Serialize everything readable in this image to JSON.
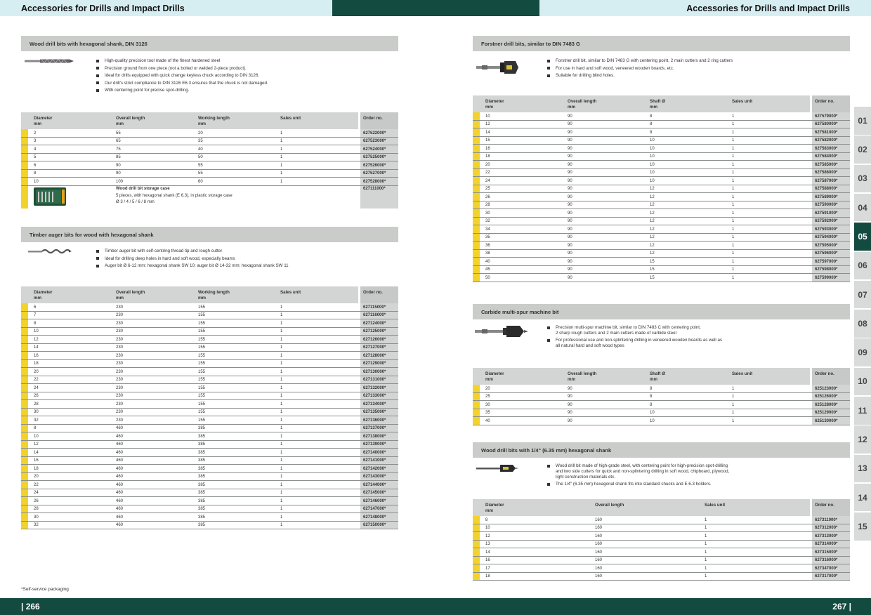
{
  "header": {
    "title_left": "Accessories for Drills and Impact Drills",
    "title_right": "Accessories for Drills and Impact Drills"
  },
  "footer": {
    "page_left": "| 266",
    "page_right": "267 |",
    "footnote": "*Self-service packaging"
  },
  "colors": {
    "dark_green": "#134b41",
    "light_blue": "#d6eef2",
    "yellow": "#f2d32e",
    "gray_bar": "#c9ccc9"
  },
  "tabs": [
    "01",
    "02",
    "03",
    "04",
    "05",
    "06",
    "07",
    "08",
    "09",
    "10",
    "11",
    "12",
    "13",
    "14",
    "15"
  ],
  "active_tab": "05",
  "sections": {
    "wood_hex": {
      "title": "Wood drill bits with hexagonal shank, DIN 3126",
      "bullets": [
        "High-quality precision tool made of the finest hardened steel",
        "Precision ground from one piece (not a bolted or welded 2-piece product).",
        "Ideal for drills equipped with quick change keyless chuck according to DIN 3126.",
        "Our drill's strict compliance to DIN 3126 E6.3 ensures that the chuck is not damaged.",
        "With centering point for precise spot-drilling."
      ],
      "headers": {
        "c1a": "Diameter",
        "c1b": "mm",
        "c2a": "Overall length",
        "c2b": "mm",
        "c3a": "Working length",
        "c3b": "mm",
        "c4": "Sales unit",
        "c5": "Order no."
      },
      "rows": [
        [
          "2",
          "55",
          "20",
          "1",
          "627522000*"
        ],
        [
          "3",
          "65",
          "35",
          "1",
          "627523000*"
        ],
        [
          "4",
          "75",
          "40",
          "1",
          "627524000*"
        ],
        [
          "5",
          "85",
          "50",
          "1",
          "627525000*"
        ],
        [
          "6",
          "90",
          "55",
          "1",
          "627526000*"
        ],
        [
          "8",
          "90",
          "55",
          "1",
          "627527000*"
        ],
        [
          "10",
          "100",
          "60",
          "1",
          "627528000*"
        ]
      ],
      "case": {
        "title": "Wood drill bit storage case",
        "line1": "5 pieces, with hexagonal shank (E 6.3), in plastic storage case",
        "line2": "Ø 3 / 4 / 5 / 6 / 8 mm",
        "order": "627111000*"
      }
    },
    "auger": {
      "title": "Timber auger bits for wood with hexagonal shank",
      "bullets": [
        "Timber auger bit with self-centring thread tip and rough cutter",
        "Ideal for drilling deep holes in hard and soft wood, especially beams",
        "Auger bit Ø 6-12 mm: hexagonal shank SW 10; auger bit Ø 14-32 mm: hexagonal shank SW 11"
      ],
      "headers": {
        "c1a": "Diameter",
        "c1b": "mm",
        "c2a": "Overall length",
        "c2b": "mm",
        "c3a": "Working length",
        "c3b": "mm",
        "c4": "Sales unit",
        "c5": "Order no."
      },
      "rows": [
        [
          "6",
          "230",
          "155",
          "1",
          "627115000*"
        ],
        [
          "7",
          "230",
          "155",
          "1",
          "627116000*"
        ],
        [
          "8",
          "230",
          "155",
          "1",
          "627124000*"
        ],
        [
          "10",
          "230",
          "155",
          "1",
          "627125000*"
        ],
        [
          "12",
          "230",
          "155",
          "1",
          "627126000*"
        ],
        [
          "14",
          "230",
          "155",
          "1",
          "627127000*"
        ],
        [
          "16",
          "230",
          "155",
          "1",
          "627128000*"
        ],
        [
          "18",
          "230",
          "155",
          "1",
          "627129000*"
        ],
        [
          "20",
          "230",
          "155",
          "1",
          "627130000*"
        ],
        [
          "22",
          "230",
          "155",
          "1",
          "627131000*"
        ],
        [
          "24",
          "230",
          "155",
          "1",
          "627132000*"
        ],
        [
          "26",
          "230",
          "155",
          "1",
          "627133000*"
        ],
        [
          "28",
          "230",
          "155",
          "1",
          "627134000*"
        ],
        [
          "30",
          "230",
          "155",
          "1",
          "627135000*"
        ],
        [
          "32",
          "230",
          "155",
          "1",
          "627136000*"
        ],
        [
          "8",
          "460",
          "385",
          "1",
          "627137000*"
        ],
        [
          "10",
          "460",
          "385",
          "1",
          "627138000*"
        ],
        [
          "12",
          "460",
          "385",
          "1",
          "627139000*"
        ],
        [
          "14",
          "460",
          "385",
          "1",
          "627140000*"
        ],
        [
          "16",
          "460",
          "385",
          "1",
          "627141000*"
        ],
        [
          "18",
          "460",
          "385",
          "1",
          "627142000*"
        ],
        [
          "20",
          "460",
          "385",
          "1",
          "627143000*"
        ],
        [
          "22",
          "460",
          "385",
          "1",
          "627144000*"
        ],
        [
          "24",
          "460",
          "385",
          "1",
          "627145000*"
        ],
        [
          "26",
          "460",
          "385",
          "1",
          "627146000*"
        ],
        [
          "28",
          "460",
          "385",
          "1",
          "627147000*"
        ],
        [
          "30",
          "460",
          "385",
          "1",
          "627148000*"
        ],
        [
          "32",
          "460",
          "385",
          "1",
          "627150000*"
        ]
      ]
    },
    "forstner": {
      "title": "Forstner drill bits, similar to DIN 7483 G",
      "bullets": [
        "Forstner drill bit, similar to DIN 7483 G with centering point, 2 main cutters and 2 ring cutters",
        "For use in hard and soft wood, veneered wooden boards, etc.",
        "Suitable for drilling blind holes."
      ],
      "headers": {
        "c1a": "Diameter",
        "c1b": "mm",
        "c2a": "Overall length",
        "c2b": "mm",
        "c3a": "Shaft Ø",
        "c3b": "mm",
        "c4": "Sales unit",
        "c5": "Order no."
      },
      "rows": [
        [
          "10",
          "90",
          "8",
          "1",
          "627579000*"
        ],
        [
          "12",
          "90",
          "8",
          "1",
          "627580000*"
        ],
        [
          "14",
          "90",
          "8",
          "1",
          "627581000*"
        ],
        [
          "15",
          "90",
          "10",
          "1",
          "627582000*"
        ],
        [
          "16",
          "90",
          "10",
          "1",
          "627583000*"
        ],
        [
          "18",
          "90",
          "10",
          "1",
          "627584000*"
        ],
        [
          "20",
          "90",
          "10",
          "1",
          "627585000*"
        ],
        [
          "22",
          "90",
          "10",
          "1",
          "627586000*"
        ],
        [
          "24",
          "90",
          "10",
          "1",
          "627587000*"
        ],
        [
          "25",
          "90",
          "12",
          "1",
          "627588000*"
        ],
        [
          "26",
          "90",
          "12",
          "1",
          "627589000*"
        ],
        [
          "28",
          "90",
          "12",
          "1",
          "627590000*"
        ],
        [
          "30",
          "90",
          "12",
          "1",
          "627591000*"
        ],
        [
          "32",
          "90",
          "12",
          "1",
          "627592000*"
        ],
        [
          "34",
          "90",
          "12",
          "1",
          "627593000*"
        ],
        [
          "35",
          "90",
          "12",
          "1",
          "627594000*"
        ],
        [
          "36",
          "90",
          "12",
          "1",
          "627595000*"
        ],
        [
          "38",
          "90",
          "12",
          "1",
          "627596000*"
        ],
        [
          "40",
          "90",
          "15",
          "1",
          "627597000*"
        ],
        [
          "45",
          "90",
          "15",
          "1",
          "627598000*"
        ],
        [
          "50",
          "90",
          "15",
          "1",
          "627599000*"
        ]
      ]
    },
    "carbide": {
      "title": "Carbide multi-spur machine bit",
      "bullets": [
        "Precision multi-spur machine bit, similar to DIN 7483 C with centering point,\n2 sharp rough cutters and 2 main cutters made of carbide steel",
        "For professional use and non-splintering drilling in veneered wooden boards as well as\nall natural hard and soft wood types"
      ],
      "headers": {
        "c1a": "Diameter",
        "c1b": "mm",
        "c2a": "Overall length",
        "c2b": "mm",
        "c3a": "Shaft Ø",
        "c3b": "mm",
        "c4": "Sales unit",
        "c5": "Order no."
      },
      "rows": [
        [
          "20",
          "90",
          "8",
          "1",
          "625123000*"
        ],
        [
          "25",
          "90",
          "8",
          "1",
          "625126000*"
        ],
        [
          "30",
          "90",
          "8",
          "1",
          "625128000*"
        ],
        [
          "35",
          "90",
          "10",
          "1",
          "625129000*"
        ],
        [
          "40",
          "90",
          "10",
          "1",
          "625130000*"
        ]
      ]
    },
    "quarter": {
      "title": "Wood drill bits with 1/4\" (6.35 mm) hexagonal shank",
      "bullets": [
        "Wood drill bit made of high-grade steel, with centering point for high-precision spot-drilling\nand two side cutters for quick and non-splintering drilling in soft wood, chipboard, plywood,\nlight construction materials etc.",
        "The 1/4\" (6.35 mm) hexagonal shank fits into standard chucks and E 6.3 holders."
      ],
      "headers": {
        "c1a": "Diameter",
        "c1b": "mm",
        "c2a": "Overall length",
        "c3": "Sales unit",
        "c4": "Order no."
      },
      "rows": [
        [
          "8",
          "160",
          "1",
          "627311000*"
        ],
        [
          "10",
          "160",
          "1",
          "627312000*"
        ],
        [
          "12",
          "160",
          "1",
          "627313000*"
        ],
        [
          "13",
          "160",
          "1",
          "627314000*"
        ],
        [
          "14",
          "160",
          "1",
          "627315000*"
        ],
        [
          "16",
          "160",
          "1",
          "627316000*"
        ],
        [
          "17",
          "160",
          "1",
          "627347000*"
        ],
        [
          "18",
          "160",
          "1",
          "627317000*"
        ]
      ]
    }
  }
}
